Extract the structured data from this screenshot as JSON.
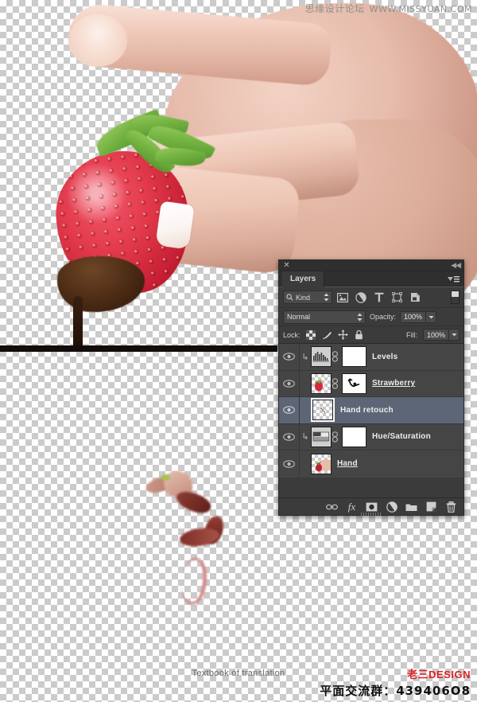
{
  "document": {
    "caption": "Textbook of translation"
  },
  "watermarks": {
    "top_cn": "思缘设计论坛",
    "top_url": "WWW.MISSYUAN.COM",
    "brand": "老三DESIGN",
    "qq_group": "平面交流群：439406O8"
  },
  "panel": {
    "title": "Layers",
    "close_icon": "close-icon",
    "collapse_icon": "collapse-to-icons-icon",
    "menu_icon": "panel-menu-icon",
    "filter": {
      "kind_label": "Kind",
      "search_icon": "search-icon",
      "stepper_icon": "updown-stepper-icon",
      "type_filters": [
        {
          "name": "filter-pixel-layers",
          "icon": "image-icon"
        },
        {
          "name": "filter-adjustment-layers",
          "icon": "adjustment-circle-icon"
        },
        {
          "name": "filter-type-layers",
          "icon": "type-T-icon"
        },
        {
          "name": "filter-shape-layers",
          "icon": "shape-bounds-icon"
        },
        {
          "name": "filter-smart-objects",
          "icon": "smart-object-icon"
        }
      ],
      "toggle_name": "filter-enable-toggle"
    },
    "blend": {
      "mode": "Normal",
      "opacity_label": "Opacity:",
      "opacity_value": "100%",
      "fill_label": "Fill:",
      "fill_value": "100%",
      "lock_label": "Lock:",
      "lock_icons": [
        {
          "name": "lock-transparent-pixels-icon",
          "icon": "checker"
        },
        {
          "name": "lock-image-pixels-icon",
          "icon": "brush"
        },
        {
          "name": "lock-position-icon",
          "icon": "move"
        },
        {
          "name": "lock-all-icon",
          "icon": "padlock"
        }
      ]
    },
    "layers": [
      {
        "name": "Levels",
        "visible": true,
        "selected": false,
        "clipped": true,
        "kind": "adjustment",
        "thumb_icon": "levels-histogram-icon",
        "has_link": true,
        "has_mask": true,
        "underline": false
      },
      {
        "name": "Strawberry",
        "visible": true,
        "selected": false,
        "clipped": false,
        "kind": "pixel",
        "thumb_icon": "strawberry-thumbnail",
        "has_link": true,
        "has_mask": true,
        "underline": true
      },
      {
        "name": "Hand retouch",
        "visible": true,
        "selected": true,
        "clipped": false,
        "kind": "pixel",
        "thumb_icon": "retouch-thumbnail",
        "has_link": false,
        "has_mask": false,
        "underline": false
      },
      {
        "name": "Hue/Saturation",
        "visible": true,
        "selected": false,
        "clipped": true,
        "kind": "adjustment",
        "thumb_icon": "hue-saturation-icon",
        "has_link": true,
        "has_mask": true,
        "underline": false
      },
      {
        "name": "Hand",
        "visible": true,
        "selected": false,
        "clipped": false,
        "kind": "pixel",
        "thumb_icon": "hand-thumbnail",
        "has_link": false,
        "has_mask": false,
        "underline": true
      }
    ],
    "footer_buttons": [
      {
        "name": "link-layers-button",
        "icon": "link-icon"
      },
      {
        "name": "add-layer-style-button",
        "icon": "fx-icon"
      },
      {
        "name": "add-layer-mask-button",
        "icon": "mask-icon"
      },
      {
        "name": "new-fill-adjustment-button",
        "icon": "half-circle-icon"
      },
      {
        "name": "new-group-button",
        "icon": "folder-icon"
      },
      {
        "name": "new-layer-button",
        "icon": "new-layer-icon"
      },
      {
        "name": "delete-layer-button",
        "icon": "trash-icon"
      }
    ]
  },
  "colors": {
    "panel_bg": "#3b3b3b",
    "list_bg": "#454545",
    "selected_row": "#5c6676",
    "text": "#ececec",
    "brand_red": "#e02020"
  }
}
